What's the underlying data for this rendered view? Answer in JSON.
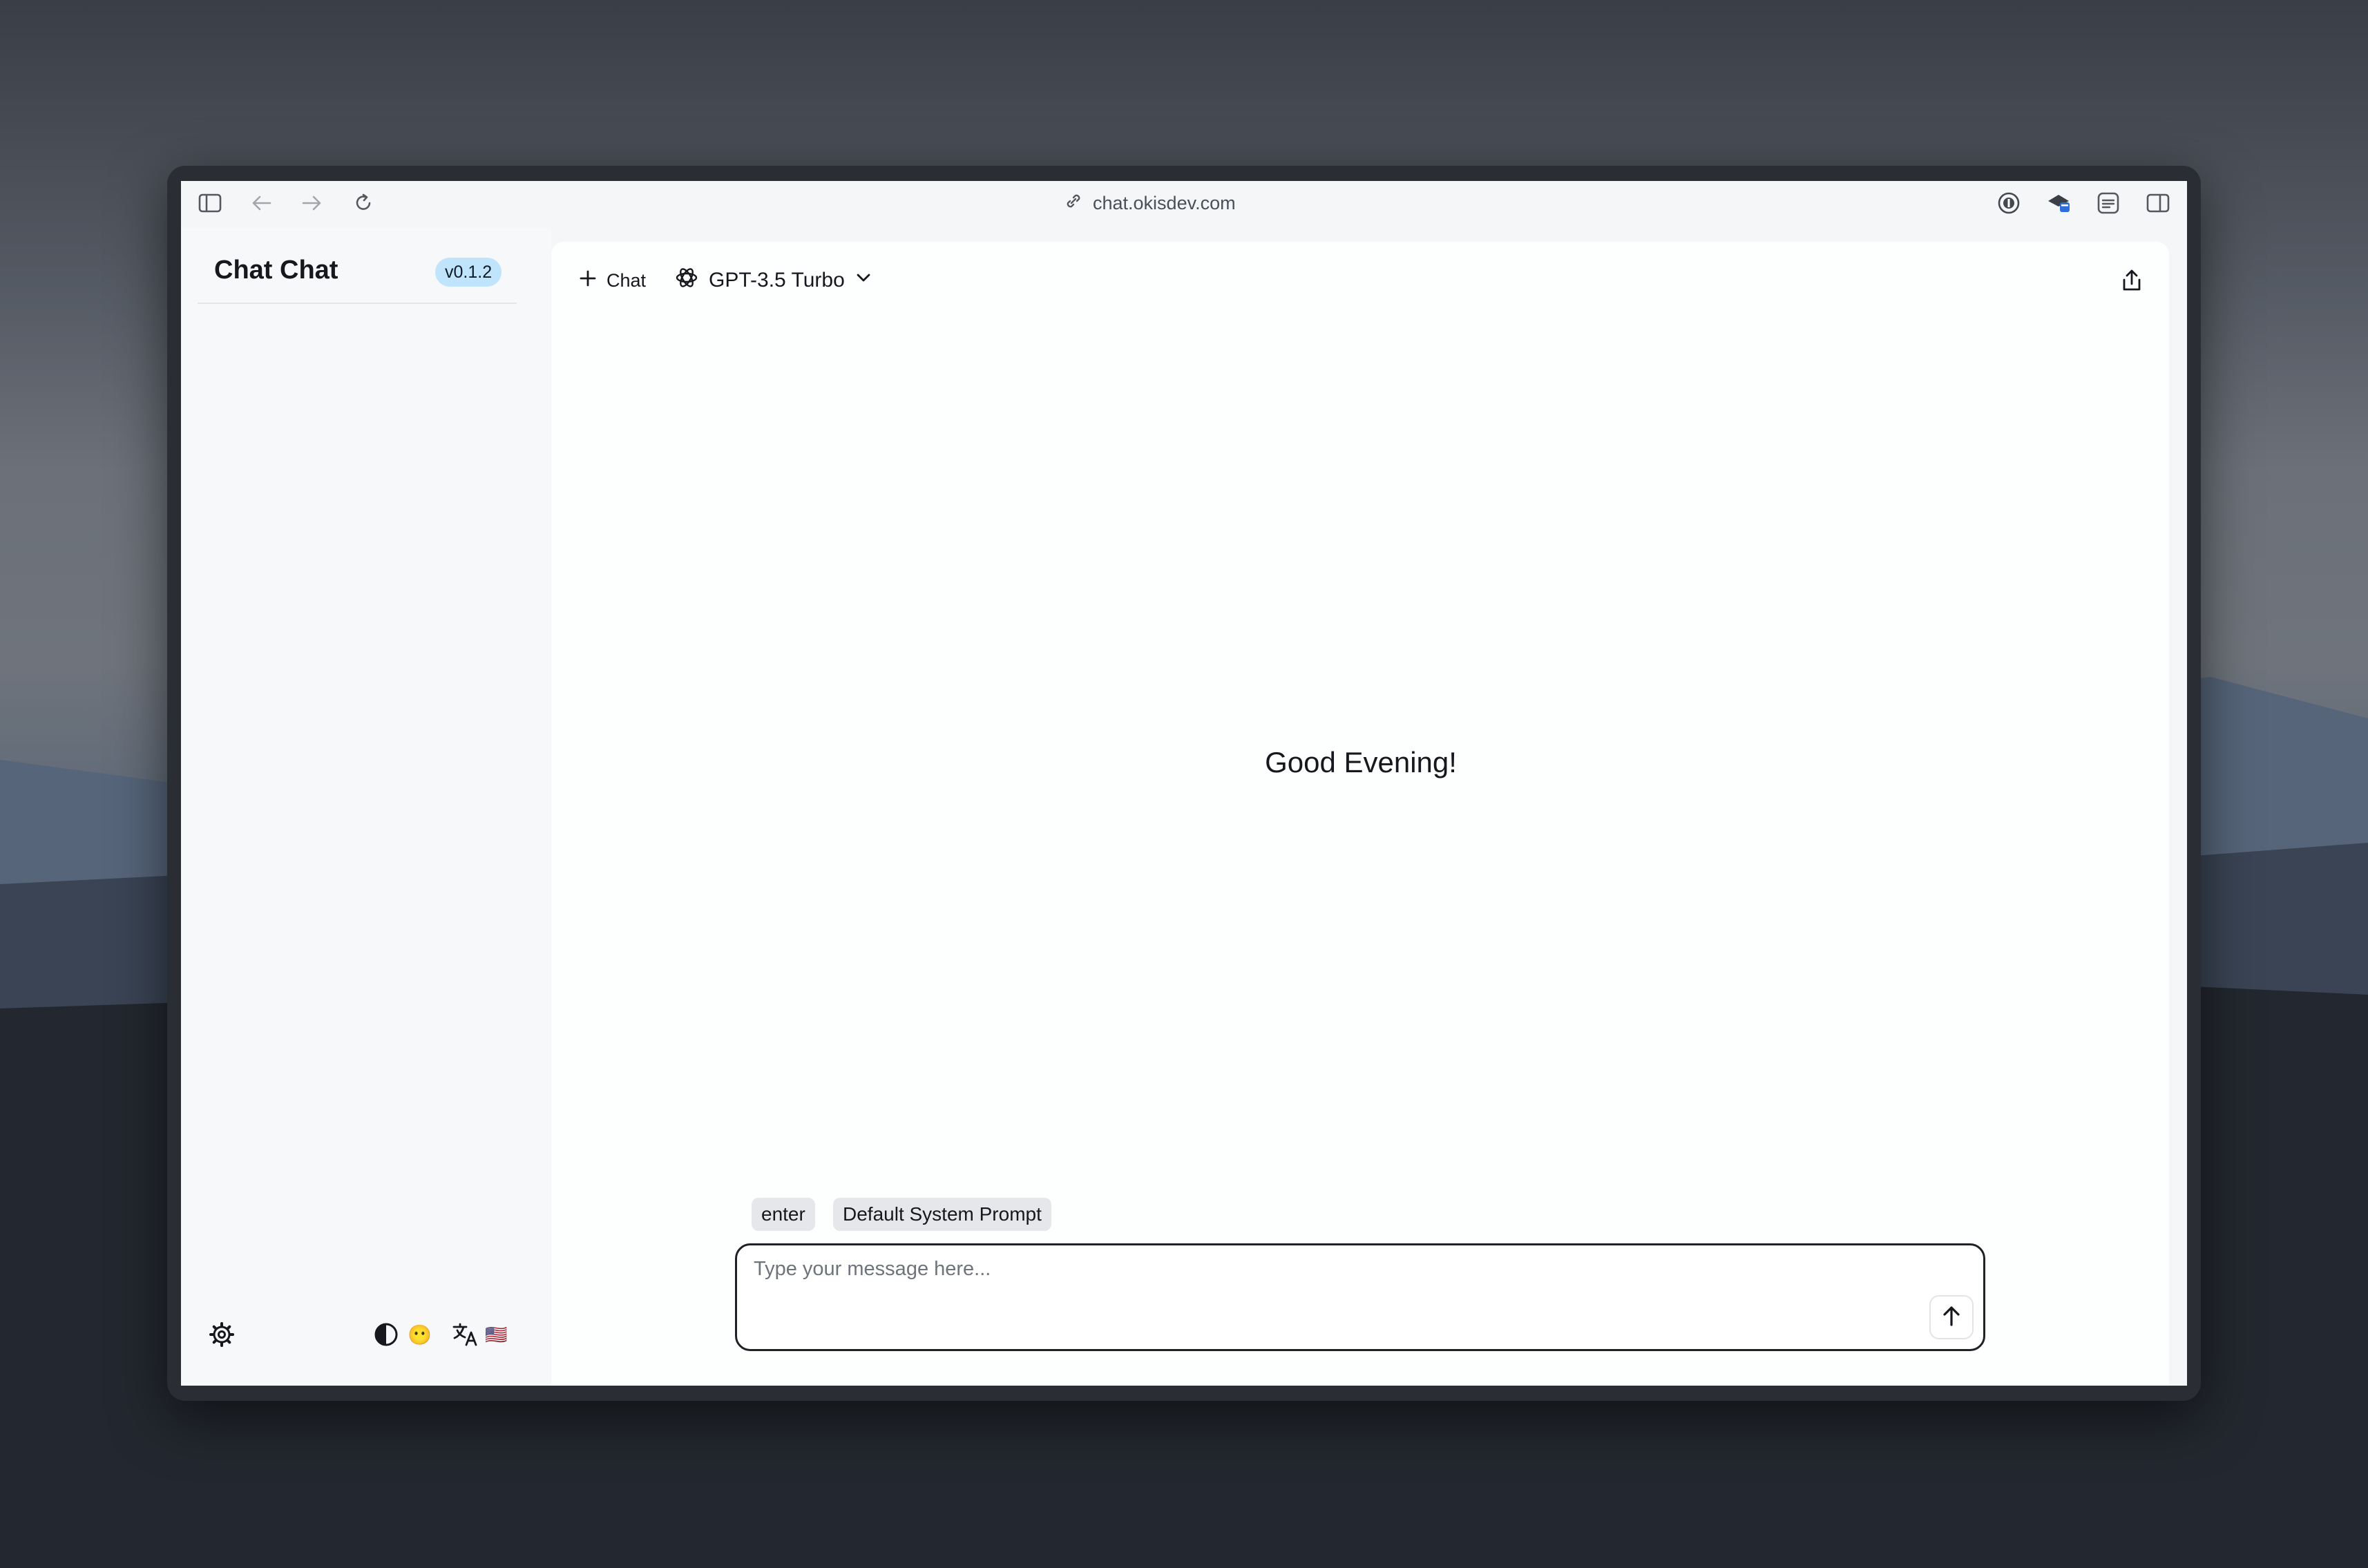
{
  "browser": {
    "url": "chat.okisdev.com",
    "icons": [
      "sidebar-toggle-icon",
      "back-arrow-icon",
      "forward-arrow-icon",
      "reload-icon",
      "link-icon",
      "password-manager-icon",
      "extension-icon",
      "reader-icon",
      "split-view-icon"
    ]
  },
  "sidebar": {
    "title": "Chat Chat",
    "version": "v0.1.2",
    "footer": {
      "settings_icon": "gear-icon",
      "theme_icon": "contrast-icon",
      "emoji": "😶",
      "language_icon": "translate-icon",
      "flag": "🇺🇸"
    }
  },
  "header": {
    "new_chat_label": "Chat",
    "model_name": "GPT-3.5 Turbo",
    "share_icon": "share-icon"
  },
  "main": {
    "greeting": "Good Evening!"
  },
  "composer": {
    "chips": [
      "enter",
      "Default System Prompt"
    ],
    "placeholder": "Type your message here...",
    "send_icon": "arrow-up-icon"
  },
  "colors": {
    "version_badge_bg": "#bfe4fb",
    "chip_bg": "#e6e7ea",
    "composer_border": "#1f2126"
  }
}
